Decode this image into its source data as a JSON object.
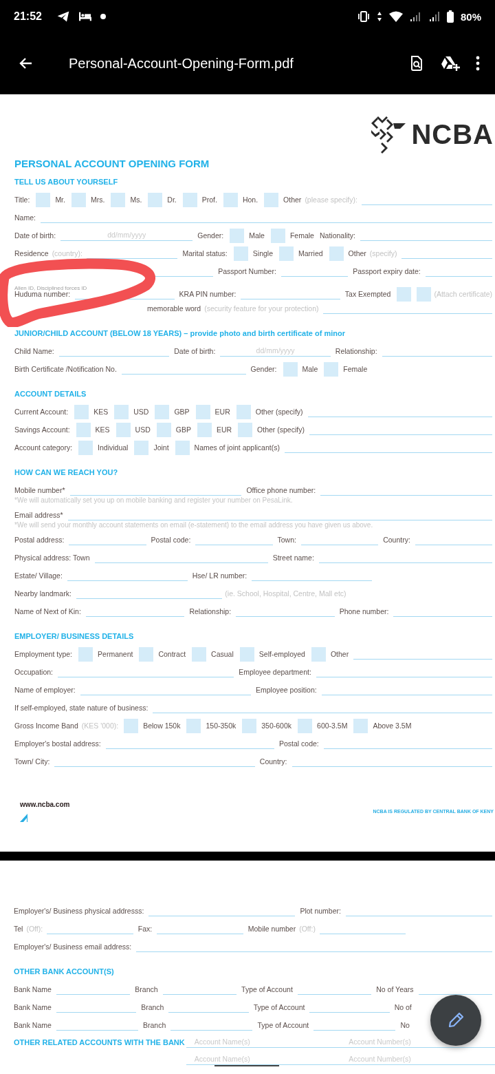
{
  "status_bar": {
    "time": "21:52",
    "battery": "80%"
  },
  "app_bar": {
    "title": "Personal-Account-Opening-Form.pdf"
  },
  "pages": [
    {
      "logo": {
        "text": "NCBA"
      },
      "rows": [
        {
          "kind": "title",
          "text": "PERSONAL ACCOUNT OPENING FORM"
        },
        {
          "kind": "heading",
          "text": "TELL US ABOUT YOURSELF"
        },
        {
          "kind": "row",
          "items": [
            {
              "kind": "label",
              "text": "Title:"
            },
            {
              "kind": "box",
              "checked": false
            },
            {
              "kind": "label",
              "text": "Mr."
            },
            {
              "kind": "box",
              "checked": false
            },
            {
              "kind": "label",
              "text": "Mrs."
            },
            {
              "kind": "box",
              "checked": false
            },
            {
              "kind": "label",
              "text": "Ms."
            },
            {
              "kind": "box",
              "checked": false
            },
            {
              "kind": "label",
              "text": "Dr."
            },
            {
              "kind": "box",
              "checked": false
            },
            {
              "kind": "label",
              "text": "Prof."
            },
            {
              "kind": "box",
              "checked": false
            },
            {
              "kind": "label",
              "text": "Hon."
            },
            {
              "kind": "box",
              "checked": false
            },
            {
              "kind": "label",
              "text": "Other"
            },
            {
              "kind": "note",
              "text": "(please specify):"
            },
            {
              "kind": "line"
            }
          ]
        },
        {
          "kind": "row",
          "items": [
            {
              "kind": "label",
              "text": "Name:"
            },
            {
              "kind": "line"
            }
          ]
        },
        {
          "kind": "row",
          "items": [
            {
              "kind": "label",
              "text": "Date of birth:"
            },
            {
              "kind": "line",
              "hint": "dd/mm/yyyy"
            },
            {
              "kind": "label",
              "text": "Gender:"
            },
            {
              "kind": "box",
              "checked": false
            },
            {
              "kind": "label",
              "text": "Male"
            },
            {
              "kind": "box",
              "checked": false
            },
            {
              "kind": "label",
              "text": "Female"
            },
            {
              "kind": "label",
              "text": "Nationality:"
            },
            {
              "kind": "line"
            }
          ]
        },
        {
          "kind": "row",
          "items": [
            {
              "kind": "label",
              "text": "Residence"
            },
            {
              "kind": "note",
              "text": "(country):"
            },
            {
              "kind": "line"
            },
            {
              "kind": "label",
              "text": "Marital status:"
            },
            {
              "kind": "box",
              "checked": false
            },
            {
              "kind": "label",
              "text": "Single"
            },
            {
              "kind": "box",
              "checked": false
            },
            {
              "kind": "label",
              "text": "Married"
            },
            {
              "kind": "box",
              "checked": false
            },
            {
              "kind": "label",
              "text": "Other"
            },
            {
              "kind": "note",
              "text": "(specify)"
            },
            {
              "kind": "line"
            }
          ]
        },
        {
          "kind": "row",
          "items": [
            {
              "kind": "covered"
            },
            {
              "kind": "line"
            },
            {
              "kind": "label",
              "text": "Passport Number:"
            },
            {
              "kind": "line"
            },
            {
              "kind": "label",
              "text": "Passport expiry date:"
            },
            {
              "kind": "line"
            }
          ]
        },
        {
          "kind": "caption",
          "text": "Alien ID, Disciplined forces ID"
        },
        {
          "kind": "row",
          "items": [
            {
              "kind": "label",
              "text": "Huduma number:"
            },
            {
              "kind": "line"
            },
            {
              "kind": "label",
              "text": "KRA PIN number:"
            },
            {
              "kind": "line"
            },
            {
              "kind": "label",
              "text": "Tax Exempted"
            },
            {
              "kind": "box",
              "checked": false
            },
            {
              "kind": "box",
              "checked": false
            },
            {
              "kind": "note",
              "text": "(Attach certificate)"
            }
          ]
        },
        {
          "kind": "row",
          "items": [
            {
              "kind": "covered"
            },
            {
              "kind": "label",
              "text": "memorable word"
            },
            {
              "kind": "note",
              "text": "(security feature for your protection)"
            },
            {
              "kind": "line"
            }
          ]
        },
        {
          "kind": "heading",
          "text": "JUNIOR/CHILD ACCOUNT (BELOW 18 YEARS) – provide photo and birth certificate of minor"
        },
        {
          "kind": "row",
          "items": [
            {
              "kind": "label",
              "text": "Child Name:"
            },
            {
              "kind": "line"
            },
            {
              "kind": "label",
              "text": "Date of birth:"
            },
            {
              "kind": "line",
              "hint": "dd/mm/yyyy"
            },
            {
              "kind": "label",
              "text": "Relationship:"
            },
            {
              "kind": "line"
            }
          ]
        },
        {
          "kind": "row",
          "items": [
            {
              "kind": "label",
              "text": "Birth Certificate /Notification No."
            },
            {
              "kind": "line"
            },
            {
              "kind": "label",
              "text": "Gender:"
            },
            {
              "kind": "box",
              "checked": false
            },
            {
              "kind": "label",
              "text": "Male"
            },
            {
              "kind": "box",
              "checked": false
            },
            {
              "kind": "label",
              "text": "Female"
            },
            {
              "kind": "blank"
            }
          ]
        },
        {
          "kind": "heading",
          "text": "ACCOUNT DETAILS"
        },
        {
          "kind": "row",
          "items": [
            {
              "kind": "label",
              "text": "Current Account:"
            },
            {
              "kind": "box",
              "checked": false
            },
            {
              "kind": "label",
              "text": "KES"
            },
            {
              "kind": "box",
              "checked": false
            },
            {
              "kind": "label",
              "text": "USD"
            },
            {
              "kind": "box",
              "checked": false
            },
            {
              "kind": "label",
              "text": "GBP"
            },
            {
              "kind": "box",
              "checked": false
            },
            {
              "kind": "label",
              "text": "EUR"
            },
            {
              "kind": "box",
              "checked": false
            },
            {
              "kind": "label",
              "text": "Other (specify)"
            },
            {
              "kind": "line"
            }
          ]
        },
        {
          "kind": "row",
          "items": [
            {
              "kind": "label",
              "text": "Savings Account:"
            },
            {
              "kind": "box",
              "checked": false
            },
            {
              "kind": "label",
              "text": "KES"
            },
            {
              "kind": "box",
              "checked": false
            },
            {
              "kind": "label",
              "text": "USD"
            },
            {
              "kind": "box",
              "checked": false
            },
            {
              "kind": "label",
              "text": "GBP"
            },
            {
              "kind": "box",
              "checked": false
            },
            {
              "kind": "label",
              "text": "EUR"
            },
            {
              "kind": "box",
              "checked": false
            },
            {
              "kind": "label",
              "text": "Other (specify)"
            },
            {
              "kind": "line"
            }
          ]
        },
        {
          "kind": "row",
          "items": [
            {
              "kind": "label",
              "text": "Account category:"
            },
            {
              "kind": "box",
              "checked": false
            },
            {
              "kind": "label",
              "text": "Individual"
            },
            {
              "kind": "box",
              "checked": false
            },
            {
              "kind": "label",
              "text": "Joint"
            },
            {
              "kind": "box",
              "checked": false
            },
            {
              "kind": "label",
              "text": "Names of joint applicant(s)"
            },
            {
              "kind": "line"
            }
          ]
        },
        {
          "kind": "heading",
          "text": "HOW CAN WE REACH YOU?"
        },
        {
          "kind": "row",
          "items": [
            {
              "kind": "label",
              "text": "Mobile number*"
            },
            {
              "kind": "line"
            },
            {
              "kind": "label",
              "text": "Office phone number:"
            },
            {
              "kind": "line"
            }
          ]
        },
        {
          "kind": "subnote",
          "text": "*We will automatically set you up on mobile banking and register your number on PesaLink."
        },
        {
          "kind": "row",
          "items": [
            {
              "kind": "label",
              "text": "Email address*"
            },
            {
              "kind": "line"
            }
          ]
        },
        {
          "kind": "subnote",
          "text": "*We will send your monthly account statements on email (e-statement) to the email address you have given us above."
        },
        {
          "kind": "row",
          "items": [
            {
              "kind": "label",
              "text": "Postal address:"
            },
            {
              "kind": "line"
            },
            {
              "kind": "label",
              "text": "Postal code:"
            },
            {
              "kind": "line"
            },
            {
              "kind": "label",
              "text": "Town:"
            },
            {
              "kind": "line"
            },
            {
              "kind": "label",
              "text": "Country:"
            },
            {
              "kind": "line"
            }
          ]
        },
        {
          "kind": "row",
          "items": [
            {
              "kind": "label",
              "text": "Physical address: Town"
            },
            {
              "kind": "line"
            },
            {
              "kind": "label",
              "text": "Street name:"
            },
            {
              "kind": "line"
            }
          ]
        },
        {
          "kind": "row",
          "items": [
            {
              "kind": "label",
              "text": "Estate/ Village:"
            },
            {
              "kind": "line"
            },
            {
              "kind": "label",
              "text": "Hse/ LR number:"
            },
            {
              "kind": "line"
            },
            {
              "kind": "blank"
            }
          ]
        },
        {
          "kind": "row",
          "items": [
            {
              "kind": "label",
              "text": "Nearby landmark:"
            },
            {
              "kind": "line"
            },
            {
              "kind": "note",
              "text": "(ie. School, Hospital, Centre, Mall etc)"
            },
            {
              "kind": "blank"
            }
          ]
        },
        {
          "kind": "row",
          "items": [
            {
              "kind": "label",
              "text": "Name of Next of Kin:"
            },
            {
              "kind": "line"
            },
            {
              "kind": "label",
              "text": "Relationship:"
            },
            {
              "kind": "line"
            },
            {
              "kind": "label",
              "text": "Phone number:"
            },
            {
              "kind": "line"
            }
          ]
        },
        {
          "kind": "heading",
          "text": "EMPLOYER/ BUSINESS DETAILS"
        },
        {
          "kind": "row",
          "items": [
            {
              "kind": "label",
              "text": "Employment type:"
            },
            {
              "kind": "box",
              "checked": false
            },
            {
              "kind": "label",
              "text": "Permanent"
            },
            {
              "kind": "box",
              "checked": false
            },
            {
              "kind": "label",
              "text": "Contract"
            },
            {
              "kind": "box",
              "checked": false
            },
            {
              "kind": "label",
              "text": "Casual"
            },
            {
              "kind": "box",
              "checked": false
            },
            {
              "kind": "label",
              "text": "Self-employed"
            },
            {
              "kind": "box",
              "checked": false
            },
            {
              "kind": "label",
              "text": "Other"
            },
            {
              "kind": "line"
            }
          ]
        },
        {
          "kind": "row",
          "items": [
            {
              "kind": "label",
              "text": "Occupation:"
            },
            {
              "kind": "line"
            },
            {
              "kind": "label",
              "text": "Employee department:"
            },
            {
              "kind": "line"
            }
          ]
        },
        {
          "kind": "row",
          "items": [
            {
              "kind": "label",
              "text": "Name of employer:"
            },
            {
              "kind": "line"
            },
            {
              "kind": "label",
              "text": "Employee position:"
            },
            {
              "kind": "line"
            }
          ]
        },
        {
          "kind": "row",
          "items": [
            {
              "kind": "label",
              "text": "If self-employed, state nature of business:"
            },
            {
              "kind": "line"
            }
          ]
        },
        {
          "kind": "row",
          "items": [
            {
              "kind": "label",
              "text": "Gross Income Band"
            },
            {
              "kind": "note",
              "text": "(KES '000):"
            },
            {
              "kind": "box",
              "checked": false
            },
            {
              "kind": "label",
              "text": "Below 150k"
            },
            {
              "kind": "box",
              "checked": false
            },
            {
              "kind": "label",
              "text": "150-350k"
            },
            {
              "kind": "box",
              "checked": false
            },
            {
              "kind": "label",
              "text": "350-600k"
            },
            {
              "kind": "box",
              "checked": false
            },
            {
              "kind": "label",
              "text": "600-3.5M"
            },
            {
              "kind": "box",
              "checked": false
            },
            {
              "kind": "label",
              "text": "Above 3.5M"
            },
            {
              "kind": "blank"
            }
          ]
        },
        {
          "kind": "row",
          "items": [
            {
              "kind": "label",
              "text": "Employer's bostal address:"
            },
            {
              "kind": "line"
            },
            {
              "kind": "label",
              "text": "Postal code:"
            },
            {
              "kind": "line"
            }
          ]
        },
        {
          "kind": "row",
          "items": [
            {
              "kind": "label",
              "text": "Town/ City:"
            },
            {
              "kind": "line"
            },
            {
              "kind": "label",
              "text": "Country:"
            },
            {
              "kind": "line"
            }
          ]
        }
      ],
      "annotation": {
        "kind": "scribble"
      },
      "footer": {
        "website": "www.ncba.com",
        "regulated": "NCBA IS REGULATED BY CENTRAL BANK OF KENY"
      }
    },
    {
      "rows": [
        {
          "kind": "row",
          "items": [
            {
              "kind": "label",
              "text": "Employer's/ Business physical addresss:"
            },
            {
              "kind": "line"
            },
            {
              "kind": "label",
              "text": "Plot number:"
            },
            {
              "kind": "line"
            }
          ]
        },
        {
          "kind": "row",
          "items": [
            {
              "kind": "label",
              "text": "Tel"
            },
            {
              "kind": "note",
              "text": "(Off):"
            },
            {
              "kind": "line"
            },
            {
              "kind": "label",
              "text": "Fax:"
            },
            {
              "kind": "line"
            },
            {
              "kind": "label",
              "text": "Mobile number"
            },
            {
              "kind": "note",
              "text": "(Off:)"
            },
            {
              "kind": "line"
            },
            {
              "kind": "blank"
            }
          ]
        },
        {
          "kind": "row",
          "items": [
            {
              "kind": "label",
              "text": "Employer's/ Business email address:"
            },
            {
              "kind": "line"
            }
          ]
        },
        {
          "kind": "heading",
          "text": "OTHER BANK ACCOUNT(S)"
        },
        {
          "kind": "row",
          "items": [
            {
              "kind": "label",
              "text": "Bank Name"
            },
            {
              "kind": "line"
            },
            {
              "kind": "label",
              "text": "Branch"
            },
            {
              "kind": "line"
            },
            {
              "kind": "label",
              "text": "Type of Account"
            },
            {
              "kind": "line"
            },
            {
              "kind": "label",
              "text": "No of Years"
            },
            {
              "kind": "line"
            }
          ]
        },
        {
          "kind": "row",
          "items": [
            {
              "kind": "label",
              "text": "Bank Name"
            },
            {
              "kind": "line"
            },
            {
              "kind": "label",
              "text": "Branch"
            },
            {
              "kind": "line"
            },
            {
              "kind": "label",
              "text": "Type of Account"
            },
            {
              "kind": "line"
            },
            {
              "kind": "label",
              "text": "No of"
            },
            {
              "kind": "blank"
            }
          ]
        },
        {
          "kind": "row",
          "items": [
            {
              "kind": "label",
              "text": "Bank Name"
            },
            {
              "kind": "line"
            },
            {
              "kind": "label",
              "text": "Branch"
            },
            {
              "kind": "line"
            },
            {
              "kind": "label",
              "text": "Type of Account"
            },
            {
              "kind": "line"
            },
            {
              "kind": "label",
              "text": "No"
            },
            {
              "kind": "blank"
            }
          ]
        }
      ],
      "related": {
        "heading": "OTHER RELATED ACCOUNTS WITH THE BANK",
        "rows": [
          [
            "Account Name(s)",
            "Account Number(s)"
          ],
          [
            "Account Name(s)",
            "Account Number(s)"
          ]
        ]
      }
    }
  ]
}
